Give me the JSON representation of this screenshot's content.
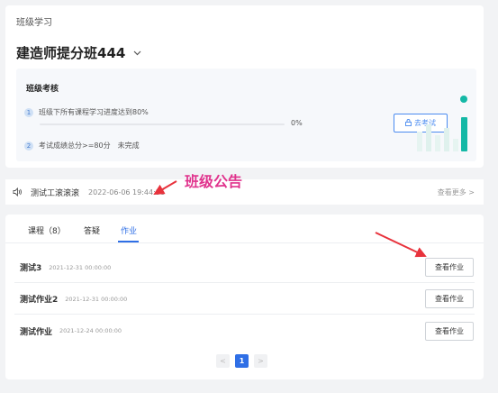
{
  "breadcrumb": "班级学习",
  "class_title": "建造师提分班444",
  "assessment": {
    "title": "班级考核",
    "requirements": [
      {
        "num": "1",
        "text": "班级下所有课程学习进度达到80%"
      },
      {
        "num": "2",
        "text": "考试成绩总分>=80分",
        "status": "未完成"
      }
    ],
    "progress_percent": 0,
    "progress_text": "0%",
    "exam_button": "去考试"
  },
  "notice": {
    "title": "测试工滚滚滚",
    "time": "2022-06-06 19:44:36",
    "more": "查看更多 >"
  },
  "annotation_label": "班级公告",
  "tabs": [
    {
      "label": "课程（8）"
    },
    {
      "label": "答疑"
    },
    {
      "label": "作业"
    }
  ],
  "active_tab": "作业",
  "homework": [
    {
      "name": "测试3",
      "date": "2021-12-31 00:00:00",
      "button": "查看作业"
    },
    {
      "name": "测试作业2",
      "date": "2021-12-31 00:00:00",
      "button": "查看作业"
    },
    {
      "name": "测试作业",
      "date": "2021-12-24 00:00:00",
      "button": "查看作业"
    }
  ],
  "pagination": {
    "prev": "<",
    "current": "1",
    "next": ">"
  },
  "colors": {
    "accent": "#2f6fe6",
    "teal": "#14b8a6",
    "annotation": "#e0338d"
  }
}
